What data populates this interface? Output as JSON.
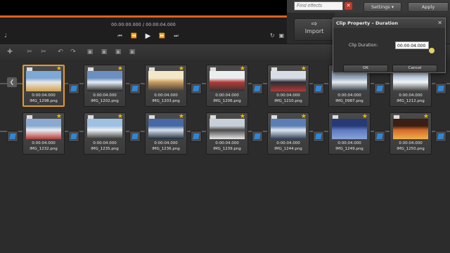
{
  "player": {
    "timecode": "00:00:00.000 / 00:00:04.000",
    "progress_fraction": 1.0
  },
  "effects": {
    "search_placeholder": "Find effects",
    "settings_label": "Settings",
    "apply_label": "Apply",
    "import_label": "Import"
  },
  "dialog": {
    "title": "Clip Property – Duration",
    "duration_label": "Clip Duration:",
    "duration_value": "00:00:04.000",
    "ok_label": "OK",
    "cancel_label": "Cancel"
  },
  "clips_row1": [
    {
      "duration": "0:00:04.000",
      "name": "IMG_1298.png",
      "selected": true,
      "thumb": [
        "#7fa8d4",
        "#e8e8ea",
        "#d0a14a"
      ]
    },
    {
      "duration": "0:00:04.000",
      "name": "IMG_1202.png",
      "thumb": [
        "#6b8fc1",
        "#e6eef5",
        "#222222"
      ]
    },
    {
      "duration": "0:00:04.000",
      "name": "IMG_1203.png",
      "thumb": [
        "#f2e8c8",
        "#c99b5c",
        "#3c3a3a"
      ]
    },
    {
      "duration": "0:00:04.000",
      "name": "IMG_1206.png",
      "thumb": [
        "#e9eef1",
        "#b23a36",
        "#333333"
      ]
    },
    {
      "duration": "0:00:04.000",
      "name": "IMG_1210.png",
      "thumb": [
        "#d9dde5",
        "#2c2c33",
        "#b23a36"
      ]
    },
    {
      "duration": "0:00:04.000",
      "name": "IMG_0987.png",
      "thumb": [
        "#9fb0c8",
        "#e7ecef",
        "#2e3540"
      ]
    },
    {
      "duration": "0:00:04.000",
      "name": "IMG_1212.png",
      "thumb": [
        "#c6d6e8",
        "#f2f4f6",
        "#3a3a3a"
      ]
    }
  ],
  "clips_row2": [
    {
      "duration": "0:00:04.000",
      "name": "IMG_1232.png",
      "thumb": [
        "#8aa9cf",
        "#e8eef3",
        "#b33a36"
      ]
    },
    {
      "duration": "0:00:04.000",
      "name": "IMG_1235.png",
      "thumb": [
        "#9ec0e2",
        "#eef2f5",
        "#333333"
      ]
    },
    {
      "duration": "0:00:04.000",
      "name": "IMG_1236.png",
      "thumb": [
        "#4668a4",
        "#d8e2ec",
        "#1e2a3a"
      ]
    },
    {
      "duration": "0:00:04.000",
      "name": "IMG_1239.png",
      "thumb": [
        "#c7cfd8",
        "#4a4a4a",
        "#e8e8e8"
      ]
    },
    {
      "duration": "0:00:04.000",
      "name": "IMG_1244.png",
      "thumb": [
        "#5b7fb5",
        "#dfe7f0",
        "#2d3d55"
      ]
    },
    {
      "duration": "0:00:04.000",
      "name": "IMG_1249.png",
      "thumb": [
        "#283a75",
        "#5b7ac0",
        "#8aa3d8"
      ]
    },
    {
      "duration": "0:00:04.000",
      "name": "IMG_1250.png",
      "thumb": [
        "#3a1f14",
        "#d46a2a",
        "#f0b04a"
      ]
    }
  ],
  "colors": {
    "accent": "#e0601e",
    "selection": "#e39a2a",
    "transition": "#2f86d6",
    "star": "#f1b800"
  }
}
